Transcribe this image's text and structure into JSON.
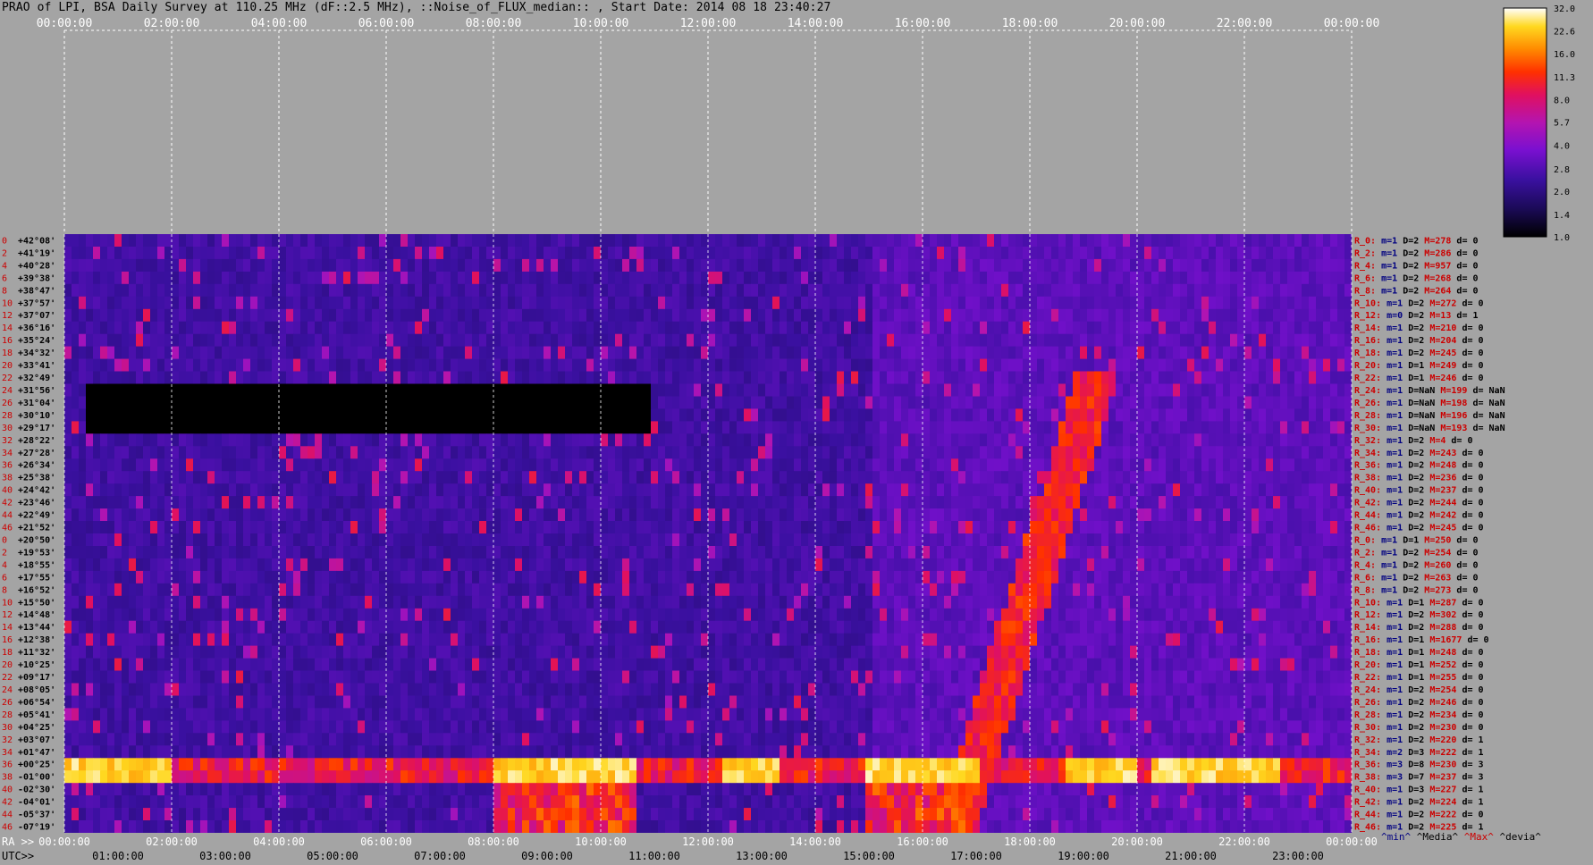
{
  "title": "PRAO of LPI, BSA Daily Survey at 110.25 MHz (dF::2.5 MHz), ::Noise_of_FLUX_median:: , Start Date: 2014 08 18 23:40:27",
  "chart_data": {
    "type": "heatmap",
    "title": "PRAO of LPI, BSA Daily Survey at 110.25 MHz (dF::2.5 MHz), ::Noise_of_FLUX_median:: , Start Date: 2014 08 18 23:40:27",
    "top_ticks": [
      "00:00:00",
      "02:00:00",
      "04:00:00",
      "06:00:00",
      "08:00:00",
      "10:00:00",
      "12:00:00",
      "14:00:00",
      "16:00:00",
      "18:00:00",
      "20:00:00",
      "22:00:00",
      "00:00:00"
    ],
    "ra_prefix": "RA >>",
    "ra_ticks": [
      "00:00:00",
      "02:00:00",
      "04:00:00",
      "06:00:00",
      "08:00:00",
      "10:00:00",
      "12:00:00",
      "14:00:00",
      "16:00:00",
      "18:00:00",
      "20:00:00",
      "22:00:00",
      "00:00:00"
    ],
    "utc_prefix": "UTC>>",
    "utc_ticks": [
      "01:00:00",
      "03:00:00",
      "05:00:00",
      "07:00:00",
      "09:00:00",
      "11:00:00",
      "13:00:00",
      "15:00:00",
      "17:00:00",
      "19:00:00",
      "21:00:00",
      "23:00:00"
    ],
    "colorbar": {
      "min": 1.0,
      "max": 32.0,
      "scale": "log",
      "tick_labels": [
        "32.0",
        "22.6",
        "16.0",
        "11.3",
        "8.0",
        "5.7",
        "4.0",
        "2.8",
        "2.0",
        "1.4",
        "1.0"
      ]
    },
    "row_index_labels": [
      "0",
      "2",
      "4",
      "6",
      "8",
      "10",
      "12",
      "14",
      "16",
      "18",
      "20",
      "22",
      "24",
      "26",
      "28",
      "30",
      "32",
      "34",
      "36",
      "38",
      "40",
      "42",
      "44",
      "46",
      "0",
      "2",
      "4",
      "6",
      "8",
      "10",
      "12",
      "14",
      "16",
      "18",
      "20",
      "22",
      "24",
      "26",
      "28",
      "30",
      "32",
      "34",
      "36",
      "38",
      "40",
      "42",
      "44",
      "46"
    ],
    "declinations": [
      "+42°08'",
      "+41°19'",
      "+40°28'",
      "+39°38'",
      "+38°47'",
      "+37°57'",
      "+37°07'",
      "+36°16'",
      "+35°24'",
      "+34°32'",
      "+33°41'",
      "+32°49'",
      "+31°56'",
      "+31°04'",
      "+30°10'",
      "+29°17'",
      "+28°22'",
      "+27°28'",
      "+26°34'",
      "+25°38'",
      "+24°42'",
      "+23°46'",
      "+22°49'",
      "+21°52'",
      "+20°50'",
      "+19°53'",
      "+18°55'",
      "+17°55'",
      "+16°52'",
      "+15°50'",
      "+14°48'",
      "+13°44'",
      "+12°38'",
      "+11°32'",
      "+10°25'",
      "+09°17'",
      "+08°05'",
      "+06°54'",
      "+05°41'",
      "+04°25'",
      "+03°07'",
      "+01°47'",
      "+00°25'",
      "-01°00'",
      "-02°30'",
      "-04°01'",
      "-05°37'",
      "-07°19'"
    ],
    "row_stats_visible": [
      {
        "name": "R_0:",
        "min": "m=1",
        "D": "D=2",
        "M": "M=278",
        "d": "d= 0"
      },
      {
        "name": "R_2:",
        "min": "m=1",
        "D": "D=2",
        "M": "M=286",
        "d": "d= 0"
      },
      {
        "name": "R_4:",
        "min": "m=1",
        "D": "D=2",
        "M": "M=957",
        "d": "d= 0"
      },
      {
        "name": "R_6:",
        "min": "m=1",
        "D": "D=2",
        "M": "M=268",
        "d": "d= 0"
      },
      {
        "name": "R_8:",
        "min": "m=1",
        "D": "D=2",
        "M": "M=264",
        "d": "d= 0"
      },
      {
        "name": "R_10:",
        "min": "m=1",
        "D": "D=2",
        "M": "M=272",
        "d": "d= 0"
      },
      {
        "name": "R_12:",
        "min": "m=0",
        "D": "D=2",
        "M": "M=13",
        "d": "d= 1"
      },
      {
        "name": "R_14:",
        "min": "m=1",
        "D": "D=2",
        "M": "M=210",
        "d": "d= 0"
      },
      {
        "name": "R_16:",
        "min": "m=1",
        "D": "D=2",
        "M": "M=204",
        "d": "d= 0"
      },
      {
        "name": "R_18:",
        "min": "m=1",
        "D": "D=2",
        "M": "M=245",
        "d": "d= 0"
      },
      {
        "name": "R_20:",
        "min": "m=1",
        "D": "D=1",
        "M": "M=249",
        "d": "d= 0"
      },
      {
        "name": "R_22:",
        "min": "m=1",
        "D": "D=1",
        "M": "M=246",
        "d": "d= 0"
      },
      {
        "name": "R_24:",
        "min": "m=1",
        "D": "D=NaN",
        "M": "M=199",
        "d": "d= NaN"
      },
      {
        "name": "R_26:",
        "min": "m=1",
        "D": "D=NaN",
        "M": "M=198",
        "d": "d= NaN"
      },
      {
        "name": "R_28:",
        "min": "m=1",
        "D": "D=NaN",
        "M": "M=196",
        "d": "d= NaN"
      },
      {
        "name": "R_30:",
        "min": "m=1",
        "D": "D=NaN",
        "M": "M=193",
        "d": "d= NaN"
      },
      {
        "name": "R_32:",
        "min": "m=1",
        "D": "D=2",
        "M": "M=4",
        "d": "d= 0"
      },
      {
        "name": "R_34:",
        "min": "m=1",
        "D": "D=2",
        "M": "M=243",
        "d": "d= 0"
      },
      {
        "name": "R_36:",
        "min": "m=1",
        "D": "D=2",
        "M": "M=248",
        "d": "d= 0"
      },
      {
        "name": "R_38:",
        "min": "m=1",
        "D": "D=2",
        "M": "M=236",
        "d": "d= 0"
      },
      {
        "name": "R_40:",
        "min": "m=1",
        "D": "D=2",
        "M": "M=237",
        "d": "d= 0"
      },
      {
        "name": "R_42:",
        "min": "m=1",
        "D": "D=2",
        "M": "M=244",
        "d": "d= 0"
      },
      {
        "name": "R_44:",
        "min": "m=1",
        "D": "D=2",
        "M": "M=242",
        "d": "d= 0"
      },
      {
        "name": "R_46:",
        "min": "m=1",
        "D": "D=2",
        "M": "M=245",
        "d": "d= 0"
      },
      {
        "name": "R_0:",
        "min": "m=1",
        "D": "D=1",
        "M": "M=250",
        "d": "d= 0"
      },
      {
        "name": "R_2:",
        "min": "m=1",
        "D": "D=2",
        "M": "M=254",
        "d": "d= 0"
      },
      {
        "name": "R_4:",
        "min": "m=1",
        "D": "D=2",
        "M": "M=260",
        "d": "d= 0"
      },
      {
        "name": "R_6:",
        "min": "m=1",
        "D": "D=2",
        "M": "M=263",
        "d": "d= 0"
      },
      {
        "name": "R_8:",
        "min": "m=1",
        "D": "D=2",
        "M": "M=273",
        "d": "d= 0"
      },
      {
        "name": "R_10:",
        "min": "m=1",
        "D": "D=1",
        "M": "M=287",
        "d": "d= 0"
      },
      {
        "name": "R_12:",
        "min": "m=1",
        "D": "D=2",
        "M": "M=302",
        "d": "d= 0"
      },
      {
        "name": "R_14:",
        "min": "m=1",
        "D": "D=2",
        "M": "M=288",
        "d": "d= 0"
      },
      {
        "name": "R_16:",
        "min": "m=1",
        "D": "D=1",
        "M": "M=1677",
        "d": "d= 0"
      },
      {
        "name": "R_18:",
        "min": "m=1",
        "D": "D=1",
        "M": "M=248",
        "d": "d= 0"
      },
      {
        "name": "R_20:",
        "min": "m=1",
        "D": "D=1",
        "M": "M=252",
        "d": "d= 0"
      },
      {
        "name": "R_22:",
        "min": "m=1",
        "D": "D=1",
        "M": "M=255",
        "d": "d= 0"
      },
      {
        "name": "R_24:",
        "min": "m=1",
        "D": "D=2",
        "M": "M=254",
        "d": "d= 0"
      },
      {
        "name": "R_26:",
        "min": "m=1",
        "D": "D=2",
        "M": "M=246",
        "d": "d= 0"
      },
      {
        "name": "R_28:",
        "min": "m=1",
        "D": "D=2",
        "M": "M=234",
        "d": "d= 0"
      },
      {
        "name": "R_30:",
        "min": "m=1",
        "D": "D=2",
        "M": "M=230",
        "d": "d= 0"
      },
      {
        "name": "R_32:",
        "min": "m=1",
        "D": "D=2",
        "M": "M=220",
        "d": "d= 1"
      },
      {
        "name": "R_34:",
        "min": "m=2",
        "D": "D=3",
        "M": "M=222",
        "d": "d= 1"
      },
      {
        "name": "R_36:",
        "min": "m=3",
        "D": "D=8",
        "M": "M=230",
        "d": "d= 3"
      },
      {
        "name": "R_38:",
        "min": "m=3",
        "D": "D=7",
        "M": "M=237",
        "d": "d= 3"
      },
      {
        "name": "R_40:",
        "min": "m=1",
        "D": "D=3",
        "M": "M=227",
        "d": "d= 1"
      },
      {
        "name": "R_42:",
        "min": "m=1",
        "D": "D=2",
        "M": "M=224",
        "d": "d= 1"
      },
      {
        "name": "R_44:",
        "min": "m=1",
        "D": "D=2",
        "M": "M=222",
        "d": "d= 0"
      },
      {
        "name": "R_46:",
        "min": "m=1",
        "D": "D=2",
        "M": "M=225",
        "d": "d= 1"
      }
    ],
    "stat_legend": [
      "^min^",
      "^Media^",
      "^Max^",
      "^devia^"
    ],
    "colors": {
      "background": "#a4a4a4",
      "stat_name": "#cc0000",
      "stat_text": "#000080",
      "row_index": "#cc0000"
    }
  }
}
